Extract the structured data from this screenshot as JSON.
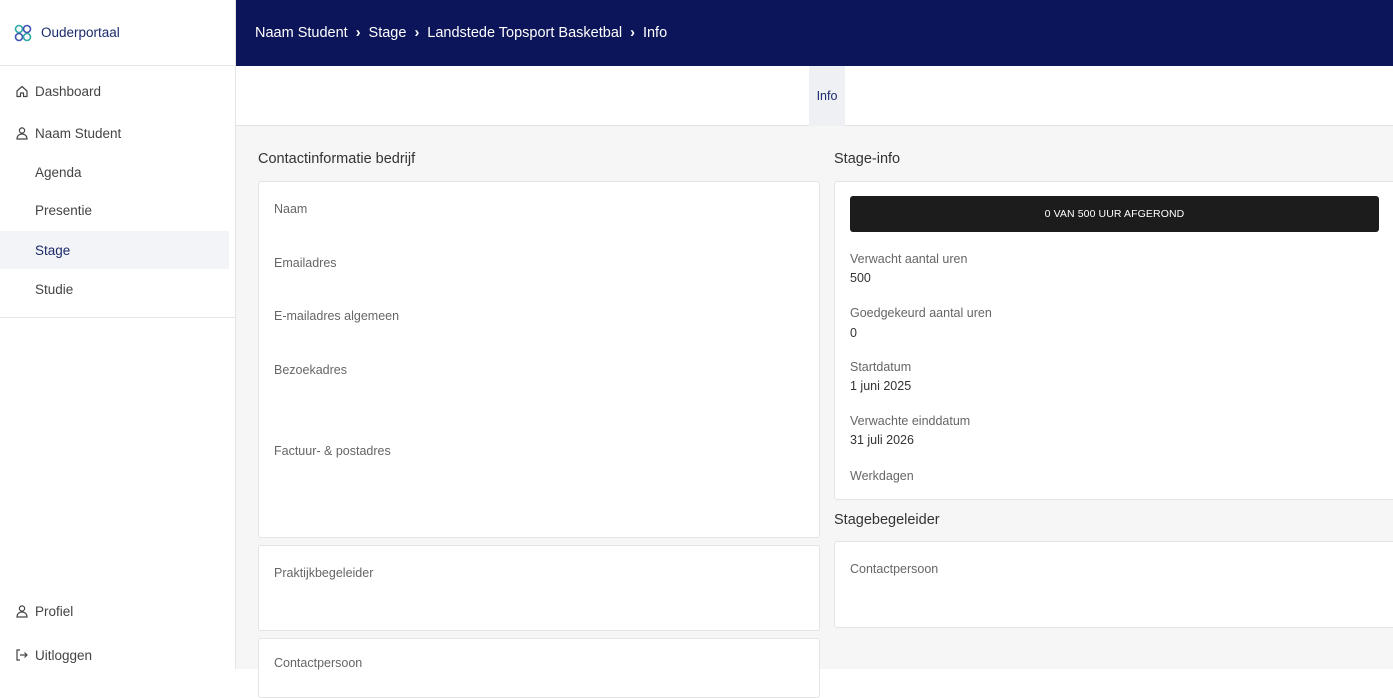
{
  "sidebar": {
    "brand": "Ouderportaal",
    "items": [
      {
        "label": "Dashboard",
        "icon": "home-icon"
      },
      {
        "label": "Naam Student",
        "icon": "person-icon"
      },
      {
        "label": "Agenda"
      },
      {
        "label": "Presentie"
      },
      {
        "label": "Stage"
      },
      {
        "label": "Studie"
      }
    ],
    "bottom": [
      {
        "label": "Profiel",
        "icon": "person-icon"
      },
      {
        "label": "Uitloggen",
        "icon": "logout-icon"
      }
    ]
  },
  "breadcrumb": [
    "Naam Student",
    "Stage",
    "Landstede Topsport Basketbal",
    "Info"
  ],
  "tabs": [
    {
      "label": "Info",
      "active": true
    }
  ],
  "company": {
    "title": "Contactinformatie bedrijf",
    "fields": [
      "Naam",
      "Emailadres",
      "E-mailadres algemeen",
      "Bezoekadres",
      "Factuur- & postadres"
    ],
    "praktijk": "Praktijkbegeleider",
    "contact": "Contactpersoon"
  },
  "stage": {
    "title": "Stage-info",
    "progress_text": "0 VAN 500 UUR AFGEROND",
    "progress_fraction": 0,
    "expected_label": "Verwacht aantal uren",
    "expected_value": "500",
    "approved_label": "Goedgekeurd aantal uren",
    "approved_value": "0",
    "start_label": "Startdatum",
    "start_value": "1 juni 2025",
    "end_label": "Verwachte einddatum",
    "end_value": "31 juli 2026",
    "workdays_label": "Werkdagen"
  },
  "supervisor": {
    "title": "Stagebegeleider",
    "contact": "Contactpersoon"
  },
  "colors": {
    "header_bg": "#0c1559",
    "brand_text": "#1b2a6b",
    "progress_bg": "#1c1c1c"
  }
}
